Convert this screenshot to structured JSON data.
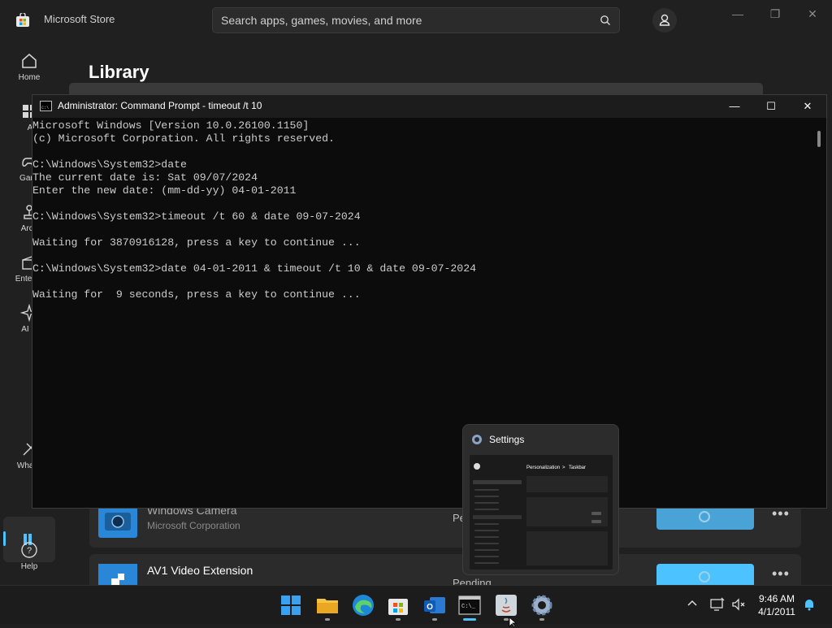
{
  "store": {
    "app_title": "Microsoft Store",
    "search_placeholder": "Search apps, games, movies, and more",
    "window_controls": {
      "minimize": "—",
      "maximize": "❐",
      "close": "✕"
    },
    "nav": [
      {
        "label": "Home",
        "icon": "home-icon"
      },
      {
        "label": "Apps",
        "icon": "apps-icon"
      },
      {
        "label": "Gaming",
        "icon": "gaming-icon"
      },
      {
        "label": "Arcade",
        "icon": "arcade-icon"
      },
      {
        "label": "Entertainment",
        "icon": "entertainment-icon"
      },
      {
        "label": "AI Hub",
        "icon": "ai-hub-icon"
      },
      {
        "label": "What's new",
        "icon": "whats-new-icon"
      },
      {
        "label": "Library",
        "icon": "library-icon"
      },
      {
        "label": "Help",
        "icon": "help-icon"
      }
    ],
    "nav_visible": {
      "home": "Home",
      "apps": "Apps",
      "gaming": "Gami",
      "arcade": "Arca",
      "entertainment": "Entertai",
      "ai_hub": "AI H",
      "whats_new": "What's",
      "help": "Help"
    },
    "page_title": "Library",
    "library_items": [
      {
        "name": "Windows Camera",
        "publisher": "Microsoft Corporation",
        "status": "Pe"
      },
      {
        "name": "AV1 Video Extension",
        "publisher": "",
        "status": "Pending"
      }
    ]
  },
  "cmd": {
    "title": "Administrator: Command Prompt - timeout  /t 10",
    "lines": [
      "Microsoft Windows [Version 10.0.26100.1150]",
      "(c) Microsoft Corporation. All rights reserved.",
      "",
      "C:\\Windows\\System32>date",
      "The current date is: Sat 09/07/2024",
      "Enter the new date: (mm-dd-yy) 04-01-2011",
      "",
      "C:\\Windows\\System32>timeout /t 60 & date 09-07-2024",
      "",
      "Waiting for 3870916128, press a key to continue ...",
      "",
      "C:\\Windows\\System32>date 04-01-2011 & timeout /t 10 & date 09-07-2024",
      "",
      "Waiting for  9 seconds, press a key to continue ..."
    ]
  },
  "preview": {
    "title": "Settings",
    "breadcrumb_parent": "Personalization",
    "breadcrumb_sep": ">",
    "breadcrumb_child": "Taskbar"
  },
  "taskbar": {
    "apps": [
      "start-icon",
      "file-explorer-icon",
      "edge-icon",
      "store-icon",
      "outlook-icon",
      "command-prompt-icon",
      "java-icon",
      "settings-icon"
    ],
    "time": "9:46 AM",
    "date": "4/1/2011"
  },
  "colors": {
    "accent": "#4cc2ff",
    "store_button": "#4aa3d6",
    "terminal_bg": "#0c0c0c",
    "terminal_text": "#cccccc"
  }
}
